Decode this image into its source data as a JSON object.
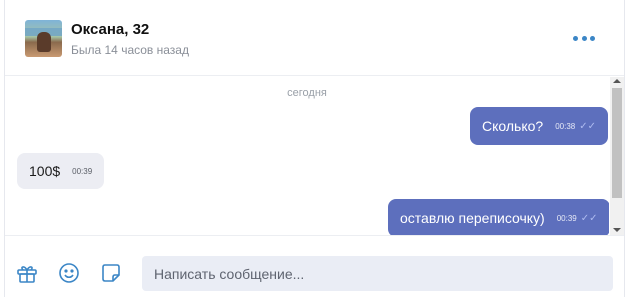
{
  "contact": {
    "name": "Оксана, 32",
    "last_seen": "Была 14 часов назад"
  },
  "conversation": {
    "day_label": "сегодня",
    "messages": [
      {
        "direction": "outgoing",
        "text": "Сколько?",
        "time": "00:38",
        "read": true
      },
      {
        "direction": "incoming",
        "text": "100$",
        "time": "00:39"
      },
      {
        "direction": "outgoing",
        "text": "оставлю переписочку)",
        "time": "00:39",
        "read": true
      }
    ]
  },
  "composer": {
    "placeholder": "Написать сообщение...",
    "icons": [
      "gift-icon",
      "smile-icon",
      "sticker-icon"
    ]
  },
  "colors": {
    "accent": "#3b86c6",
    "outgoing_bubble": "#5d6fbd",
    "incoming_bubble": "#ecedf3",
    "input_bg": "#eaedf5"
  }
}
